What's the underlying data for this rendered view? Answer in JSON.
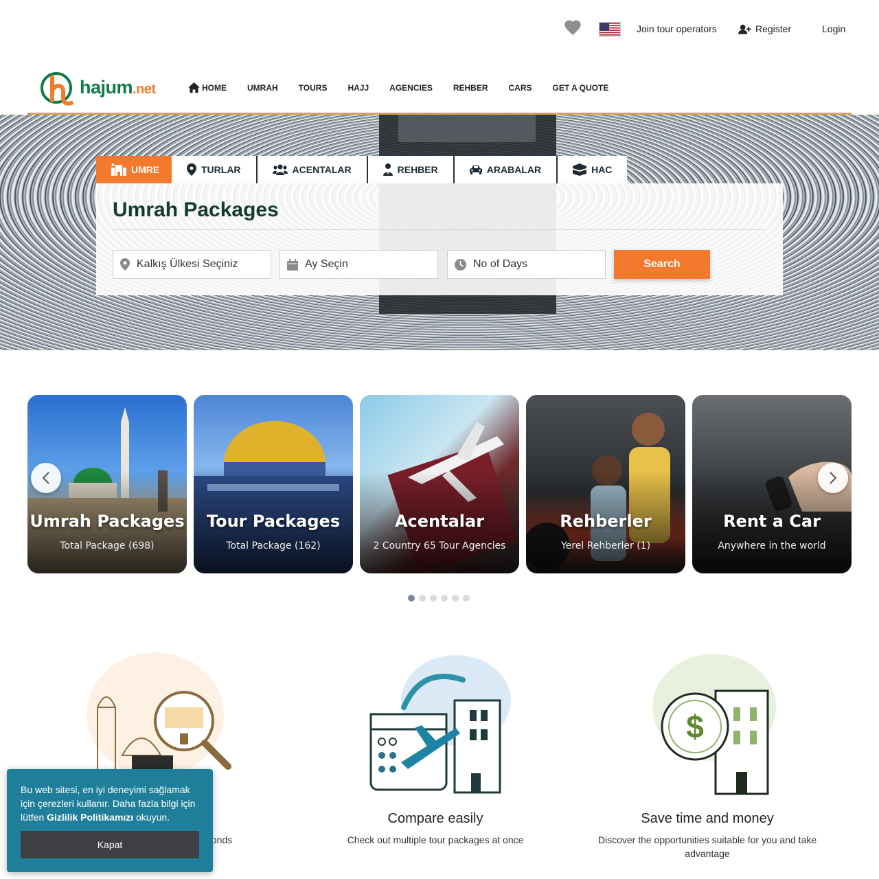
{
  "topbar": {
    "join_label": "Join tour operators",
    "register_label": "Register",
    "login_label": "Login"
  },
  "brand": {
    "name": "hajum",
    "tld": ".net"
  },
  "nav": {
    "home": "HOME",
    "umrah": "UMRAH",
    "tours": "TOURS",
    "hajj": "HAJJ",
    "agencies": "AGENCIES",
    "rehber": "REHBER",
    "cars": "CARS",
    "quote": "GET A QUOTE"
  },
  "search": {
    "tabs": {
      "umre": "UMRE",
      "turlar": "TURLAR",
      "acentalar": "ACENTALAR",
      "rehber": "REHBER",
      "arabalar": "ARABALAR",
      "hac": "HAC"
    },
    "title": "Umrah Packages",
    "country_placeholder": "Kalkış Ülkesi Seçiniz",
    "month_placeholder": "Ay Seçin",
    "days_placeholder": "No of Days",
    "button": "Search"
  },
  "cards": {
    "umrah": {
      "title": "Umrah Packages",
      "sub": "Total Package (698)"
    },
    "tour": {
      "title": "Tour Packages",
      "sub": "Total Package (162)"
    },
    "acentalar": {
      "title": "Acentalar",
      "sub": "2 Country 65 Tour Agencies"
    },
    "rehberler": {
      "title": "Rehberler",
      "sub": "Yerel Rehberler (1)"
    },
    "car": {
      "title": "Rent a Car",
      "sub": "Anywhere in the world"
    }
  },
  "carousel": {
    "dot_count": 6,
    "active_dot": 1
  },
  "features": {
    "first_desc_tail": "w seconds",
    "compare": {
      "title": "Compare easily",
      "desc": "Check out multiple tour packages at once"
    },
    "save": {
      "title": "Save time and money",
      "desc": "Discover the opportunities suitable for you and take advantage"
    }
  },
  "cookie": {
    "text_before": "Bu web sitesi, en iyi deneyimi sağlamak için çerezleri kullanır. Daha fazla bilgi için lütfen ",
    "link": "Gizlilik Politikamızı",
    "text_after": " okuyun.",
    "button": "Kapat"
  },
  "colors": {
    "accent": "#f37a2c",
    "brand_green": "#0f7a46",
    "title_green": "#143a2e",
    "cookie_bg": "#1f7f9a",
    "nav_line": "#d6a15a"
  },
  "icons": [
    "heart-icon",
    "us-flag-icon",
    "add-user-icon",
    "home-icon",
    "hotel-icon",
    "map-pin-icon",
    "users-icon",
    "guide-icon",
    "car-icon",
    "kaaba-icon",
    "location-icon",
    "calendar-icon",
    "clock-icon",
    "chevron-left-icon",
    "chevron-right-icon"
  ]
}
